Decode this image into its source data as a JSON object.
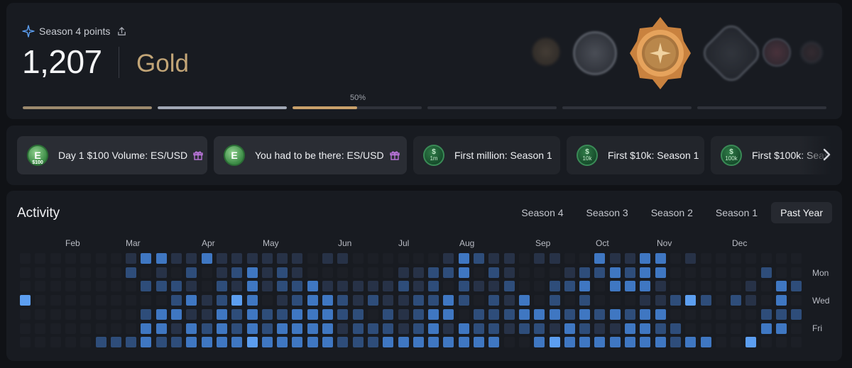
{
  "season": {
    "label": "Season 4 points",
    "points": "1,207",
    "tier": "Gold",
    "progress_label": "50%",
    "segments": [
      {
        "color": "#9c8a6d",
        "fill": 1.0
      },
      {
        "color": "#a1a8b5",
        "fill": 1.0
      },
      {
        "color": "#c9a06a",
        "fill": 0.5
      },
      {
        "color": "#2f323a",
        "fill": 0
      },
      {
        "color": "#2f323a",
        "fill": 0
      },
      {
        "color": "#2f323a",
        "fill": 0
      }
    ],
    "medal_names": [
      "bronze-medal-icon",
      "silver-medal-icon",
      "gold-medal-icon",
      "platinum-medal-icon",
      "diamond-medal-icon",
      "champion-medal-icon"
    ]
  },
  "badges": [
    {
      "label": "Day 1 $100 Volume: ES/USD",
      "coin": "$100",
      "style": "e",
      "gift": true
    },
    {
      "label": "You had to be there: ES/USD",
      "coin": "",
      "style": "e",
      "gift": true
    },
    {
      "label": "First million: Season 1",
      "coin": "1m",
      "style": "d",
      "gift": false
    },
    {
      "label": "First $10k: Season 1",
      "coin": "10k",
      "style": "d",
      "gift": false
    },
    {
      "label": "First $100k: Season 1",
      "coin": "100k",
      "style": "d",
      "gift": false
    }
  ],
  "activity": {
    "title": "Activity",
    "tabs": [
      "Season 4",
      "Season 3",
      "Season 2",
      "Season 1",
      "Past Year"
    ],
    "active_tab": "Past Year",
    "months": [
      "Feb",
      "Mar",
      "Apr",
      "May",
      "Jun",
      "Jul",
      "Aug",
      "Sep",
      "Oct",
      "Nov",
      "Dec"
    ],
    "days": [
      "Mon",
      "Wed",
      "Fri"
    ],
    "levels": [
      "0000000133113111111011000000132110110031133010000000",
      "0000000201020123121000000112230210001223233000000200",
      "0000000022210213122311111212021120022303331000001032",
      "4000000000231243012332121122320213020200011242021030",
      "0000000023311323223332202123302223332323233000000222",
      "0000000033132323233331222123132212213211332200000330",
      "0000022232233334333332223333333300343333333233004000"
    ],
    "colors": [
      "#1c1f26",
      "#273247",
      "#2e4d7a",
      "#3f77c2",
      "#5c9ef0"
    ]
  }
}
